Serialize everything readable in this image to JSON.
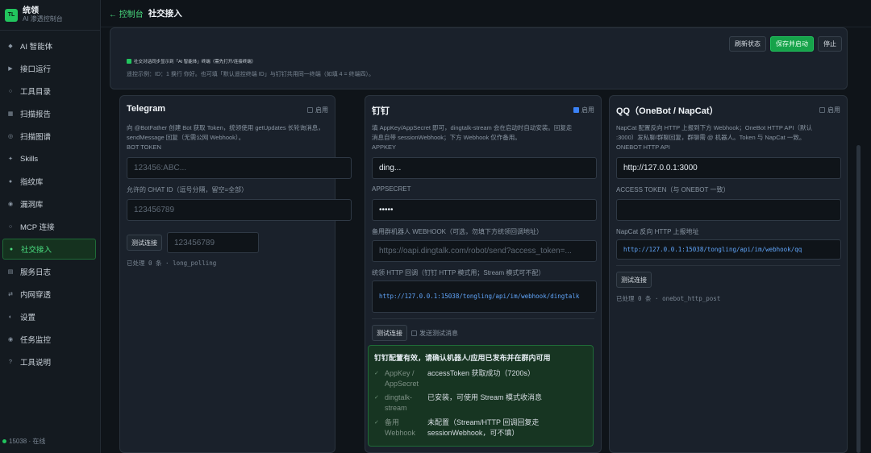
{
  "brand": {
    "logo": "TL",
    "name": "统领",
    "subtitle": "AI 渗透控制台"
  },
  "nav": [
    {
      "icon": "◆",
      "label": "AI 智能体"
    },
    {
      "icon": "▶",
      "label": "接口运行"
    },
    {
      "icon": "○",
      "label": "工具目录"
    },
    {
      "icon": "▦",
      "label": "扫描报告"
    },
    {
      "icon": "◎",
      "label": "扫描图谱"
    },
    {
      "icon": "✦",
      "label": "Skills"
    },
    {
      "icon": "●",
      "label": "指纹库"
    },
    {
      "icon": "◉",
      "label": "漏洞库"
    },
    {
      "icon": "○",
      "label": "MCP 连接"
    },
    {
      "icon": "●",
      "label": "社交接入"
    },
    {
      "icon": "▤",
      "label": "服务日志"
    },
    {
      "icon": "⇄",
      "label": "内网穿透"
    },
    {
      "icon": "◐",
      "label": "设置"
    },
    {
      "icon": "◉",
      "label": "任务监控"
    },
    {
      "icon": "?",
      "label": "工具说明"
    }
  ],
  "status": "15038 · 在线",
  "header": {
    "back": "← 控制台",
    "title": "社交接入"
  },
  "toolbar": {
    "refresh": "刷新状态",
    "save": "保存并启动",
    "stop": "停止"
  },
  "sync_label": "社交对话同步显示到「AI 智能体」终端（需先打开/连接终端）",
  "hint": "遥控示例：ID：1 换行 你好。也可填「默认遥控终端 ID」与钉钉共用同一终端（如填 4 = 终端四）。",
  "telegram": {
    "title": "Telegram",
    "enable": "启用",
    "desc": [
      "向 @BotFather 创建 Bot 获取 Token，统领使用 getUpdates 长轮询消息，",
      "sendMessage 回复（无需公网 Webhook）。"
    ],
    "token_label": "BOT TOKEN",
    "token_placeholder": "123456:ABC...",
    "chat_label": "允许的 CHAT ID（逗号分隔，留空=全部）",
    "chat_placeholder": "123456789",
    "test": "测试连接",
    "test_placeholder": "123456789",
    "note": "已处理 0 条 · long_polling"
  },
  "dingtalk": {
    "title": "钉钉",
    "enable": "启用",
    "desc": [
      "填 AppKey/AppSecret 即可，dingtalk-stream 会在启动时自动安装。回复走",
      "消息自带 sessionWebhook；下方 Webhook 仅作备用。"
    ],
    "appkey_label": "APPKEY",
    "appkey_value": "ding...",
    "secret_label": "APPSECRET",
    "secret_value": "•••••",
    "webhook_label": "备用群机器人 WEBHOOK（可选，勿填下方统领回调地址）",
    "webhook_placeholder": "https://oapi.dingtalk.com/robot/send?access_token=...",
    "callback_label": "统领 HTTP 回调（钉钉 HTTP 模式用；Stream 模式可不配）",
    "callback_value": "http://127.0.0.1:15038/tongling/api/im/webhook/dingtalk",
    "test": "测试连接",
    "send_test": "发送测试消息",
    "result_title": "钉钉配置有效，请确认机器人/应用已发布并在群内可用",
    "result_rows": [
      {
        "k": "AppKey / AppSecret",
        "v": "accessToken 获取成功（7200s）"
      },
      {
        "k": "dingtalk-stream",
        "v": "已安装，可使用 Stream 模式收消息"
      },
      {
        "k": "备用 Webhook",
        "v": "未配置（Stream/HTTP 回调回复走 sessionWebhook，可不填）"
      }
    ]
  },
  "qq": {
    "title": "QQ（OneBot / NapCat）",
    "enable": "启用",
    "desc": [
      "NapCat 配置反向 HTTP 上报到下方 Webhook；OneBot HTTP API（默认",
      ":3000）发私聊/群聊回复，群聊需 @ 机器人。Token 与 NapCat 一致。"
    ],
    "api_label": "ONEBOT HTTP API",
    "api_value": "http://127.0.0.1:3000",
    "token_label": "ACCESS TOKEN（与 ONEBOT 一致）",
    "token_value": "",
    "report_label": "NapCat 反向 HTTP 上报地址",
    "report_value": "http://127.0.0.1:15038/tongling/api/im/webhook/qq",
    "test": "测试连接",
    "note": "已处理 0 条 · onebot_http_post"
  }
}
